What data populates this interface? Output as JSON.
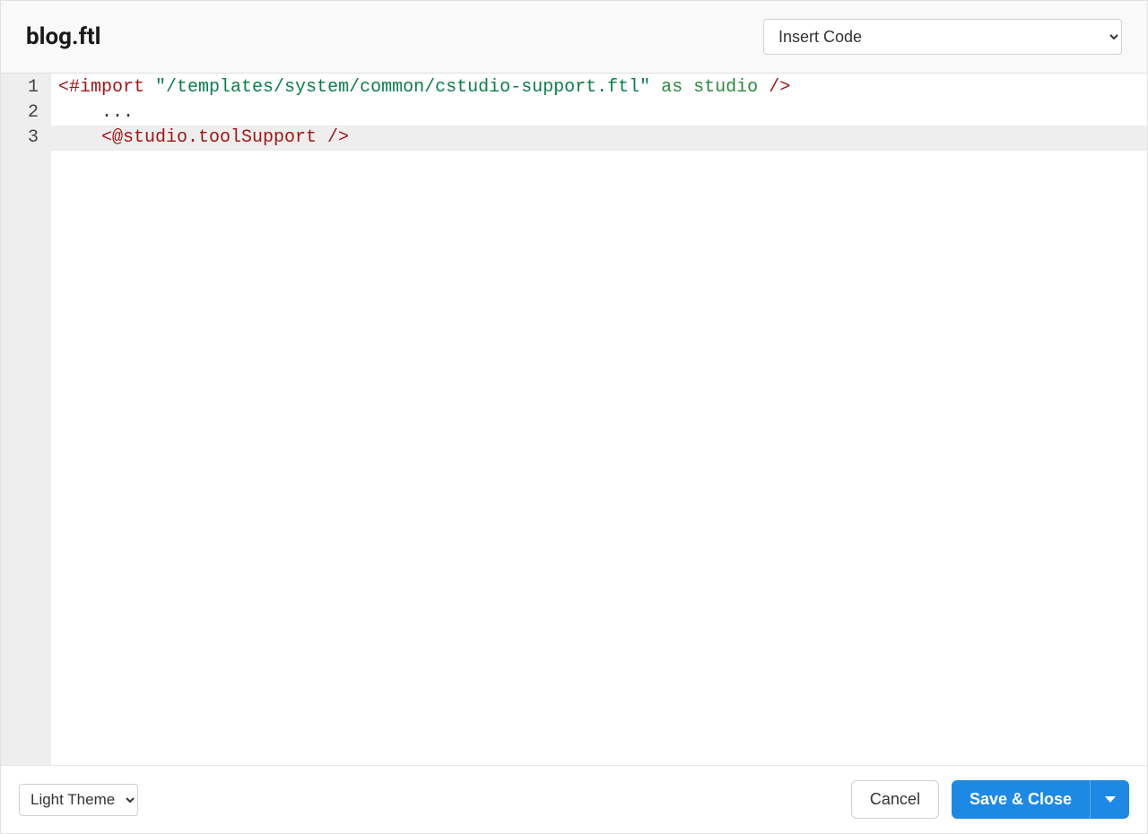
{
  "header": {
    "filename": "blog.ftl",
    "insert_code_label": "Insert Code"
  },
  "editor": {
    "lines": [
      {
        "num": "1",
        "highlighted": false,
        "tokens": [
          {
            "cls": "tok-tag",
            "text": "<#import"
          },
          {
            "cls": "tok-default",
            "text": " "
          },
          {
            "cls": "tok-string",
            "text": "\"/templates/system/common/cstudio-support.ftl\""
          },
          {
            "cls": "tok-default",
            "text": " "
          },
          {
            "cls": "tok-keyword",
            "text": "as"
          },
          {
            "cls": "tok-default",
            "text": " "
          },
          {
            "cls": "tok-ident",
            "text": "studio"
          },
          {
            "cls": "tok-default",
            "text": " "
          },
          {
            "cls": "tok-tag",
            "text": "/>"
          }
        ]
      },
      {
        "num": "2",
        "highlighted": false,
        "tokens": [
          {
            "cls": "tok-default",
            "text": "    ..."
          }
        ]
      },
      {
        "num": "3",
        "highlighted": true,
        "tokens": [
          {
            "cls": "tok-default",
            "text": "    "
          },
          {
            "cls": "tok-tag",
            "text": "<@studio.toolSupport />"
          }
        ]
      }
    ]
  },
  "footer": {
    "theme_label": "Light Theme",
    "cancel_label": "Cancel",
    "save_label": "Save & Close"
  }
}
